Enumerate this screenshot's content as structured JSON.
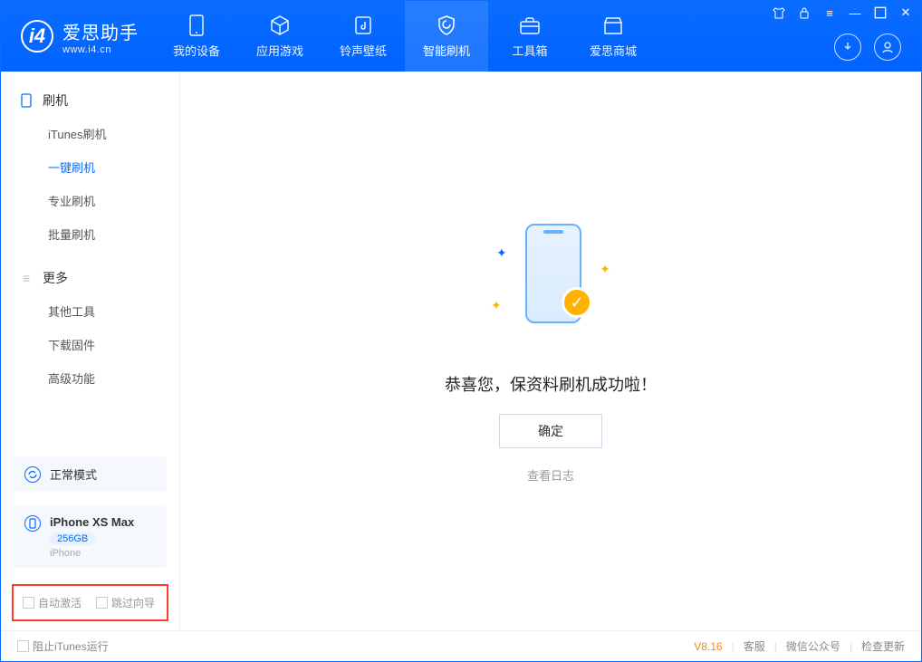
{
  "brand": {
    "cn": "爱思助手",
    "en": "www.i4.cn"
  },
  "nav": {
    "device": "我的设备",
    "apps": "应用游戏",
    "ringtone": "铃声壁纸",
    "flash": "智能刷机",
    "toolbox": "工具箱",
    "store": "爱思商城"
  },
  "sidebar": {
    "flash_group": "刷机",
    "items_flash": {
      "itunes": "iTunes刷机",
      "onekey": "一键刷机",
      "pro": "专业刷机",
      "batch": "批量刷机"
    },
    "more_group": "更多",
    "items_more": {
      "other": "其他工具",
      "firmware": "下载固件",
      "advanced": "高级功能"
    },
    "mode": "正常模式",
    "device_name": "iPhone XS Max",
    "storage": "256GB",
    "device_type": "iPhone",
    "auto_activate": "自动激活",
    "skip_guide": "跳过向导"
  },
  "main": {
    "success": "恭喜您，保资料刷机成功啦！",
    "ok": "确定",
    "view_log": "查看日志"
  },
  "status": {
    "block_itunes": "阻止iTunes运行",
    "version": "V8.16",
    "support": "客服",
    "wechat": "微信公众号",
    "update": "检查更新"
  }
}
